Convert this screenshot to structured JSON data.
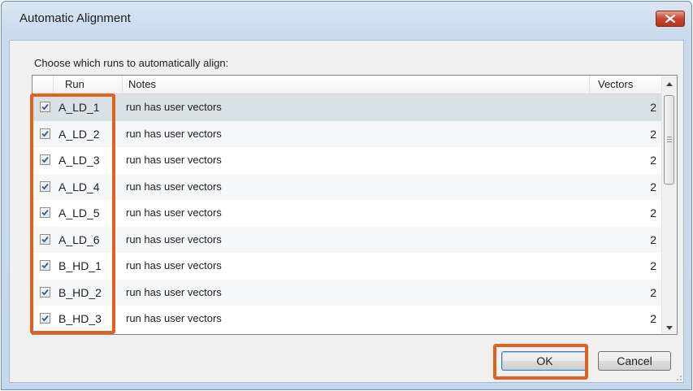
{
  "dialog": {
    "title": "Automatic Alignment",
    "prompt": "Choose which runs to automatically align:"
  },
  "table": {
    "columns": {
      "run": "Run",
      "notes": "Notes",
      "vectors": "Vectors"
    },
    "rows": [
      {
        "checked": true,
        "run": "A_LD_1",
        "notes": "run has user vectors",
        "vectors": "2",
        "selected": true
      },
      {
        "checked": true,
        "run": "A_LD_2",
        "notes": "run has user vectors",
        "vectors": "2"
      },
      {
        "checked": true,
        "run": "A_LD_3",
        "notes": "run has user vectors",
        "vectors": "2"
      },
      {
        "checked": true,
        "run": "A_LD_4",
        "notes": "run has user vectors",
        "vectors": "2"
      },
      {
        "checked": true,
        "run": "A_LD_5",
        "notes": "run has user vectors",
        "vectors": "2"
      },
      {
        "checked": true,
        "run": "A_LD_6",
        "notes": "run has user vectors",
        "vectors": "2"
      },
      {
        "checked": true,
        "run": "B_HD_1",
        "notes": "run has user vectors",
        "vectors": "2"
      },
      {
        "checked": true,
        "run": "B_HD_2",
        "notes": "run has user vectors",
        "vectors": "2"
      },
      {
        "checked": true,
        "run": "B_HD_3",
        "notes": "run has user vectors",
        "vectors": "2"
      }
    ]
  },
  "buttons": {
    "ok": "OK",
    "cancel": "Cancel"
  },
  "icons": {
    "close": "close-icon",
    "scroll_up": "scroll-up-arrow-icon",
    "scroll_down": "scroll-down-arrow-icon",
    "checkmark": "checkmark-icon"
  },
  "colors": {
    "highlight": "#e0621f",
    "selected_row": "#d8e1e3",
    "close_button": "#c8452f"
  }
}
